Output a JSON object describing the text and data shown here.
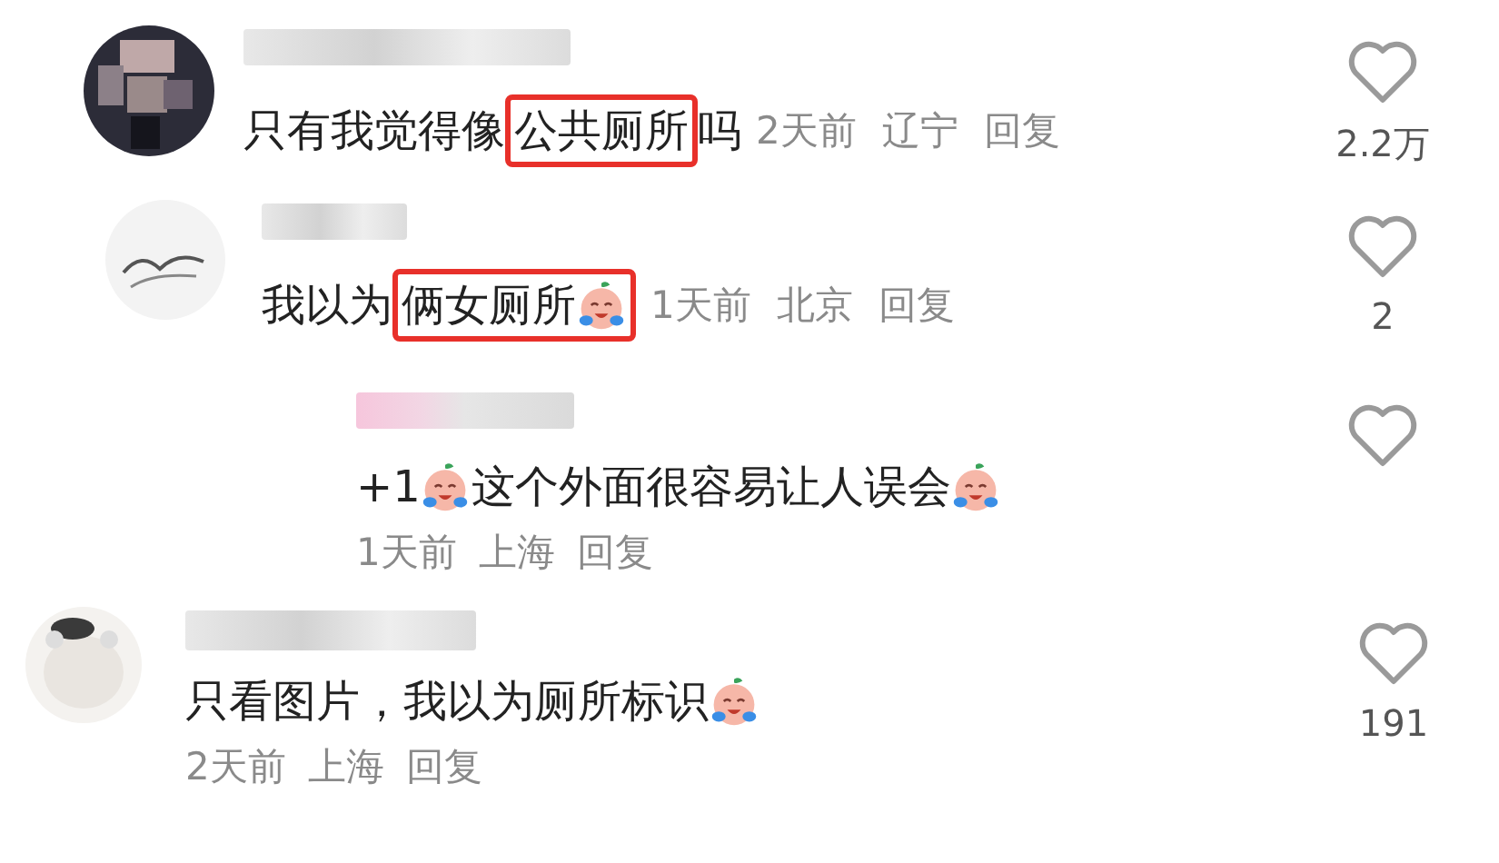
{
  "comments": [
    {
      "avatar": {
        "kind": "picture"
      },
      "content": [
        {
          "kind": "text",
          "text": "只有我觉得像"
        },
        {
          "kind": "highlight",
          "parts": [
            {
              "kind": "text",
              "text": "公共厕所"
            }
          ]
        },
        {
          "kind": "text",
          "text": "吗"
        }
      ],
      "time": "2天前",
      "location": "辽宁",
      "reply": "回复",
      "likes": "2.2万",
      "children": [
        {
          "avatar": {
            "kind": "picture"
          },
          "content": [
            {
              "kind": "text",
              "text": "我以为"
            },
            {
              "kind": "highlight",
              "parts": [
                {
                  "kind": "text",
                  "text": "俩女厕所"
                },
                {
                  "kind": "emoji"
                }
              ]
            }
          ],
          "time": "1天前",
          "location": "北京",
          "reply": "回复",
          "likes": "2"
        },
        {
          "content": [
            {
              "kind": "text",
              "text": "+1"
            },
            {
              "kind": "emoji"
            },
            {
              "kind": "text",
              "text": "这个外面很容易让人误会"
            },
            {
              "kind": "emoji"
            }
          ],
          "time": "1天前",
          "location": "上海",
          "reply": "回复"
        }
      ]
    },
    {
      "avatar": {
        "kind": "picture"
      },
      "content": [
        {
          "kind": "text",
          "text": "只看图片，我以为厕所标识"
        },
        {
          "kind": "emoji"
        }
      ],
      "time": "2天前",
      "location": "上海",
      "reply": "回复",
      "likes": "191"
    }
  ]
}
